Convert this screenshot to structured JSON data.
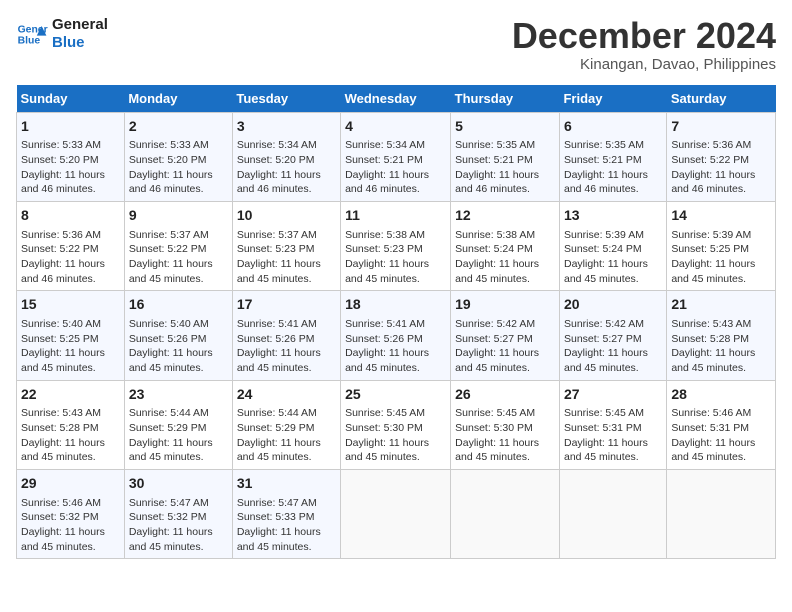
{
  "logo": {
    "line1": "General",
    "line2": "Blue"
  },
  "title": "December 2024",
  "subtitle": "Kinangan, Davao, Philippines",
  "days_header": [
    "Sunday",
    "Monday",
    "Tuesday",
    "Wednesday",
    "Thursday",
    "Friday",
    "Saturday"
  ],
  "weeks": [
    [
      {
        "day": "1",
        "sunrise": "5:33 AM",
        "sunset": "5:20 PM",
        "daylight": "11 hours and 46 minutes."
      },
      {
        "day": "2",
        "sunrise": "5:33 AM",
        "sunset": "5:20 PM",
        "daylight": "11 hours and 46 minutes."
      },
      {
        "day": "3",
        "sunrise": "5:34 AM",
        "sunset": "5:20 PM",
        "daylight": "11 hours and 46 minutes."
      },
      {
        "day": "4",
        "sunrise": "5:34 AM",
        "sunset": "5:21 PM",
        "daylight": "11 hours and 46 minutes."
      },
      {
        "day": "5",
        "sunrise": "5:35 AM",
        "sunset": "5:21 PM",
        "daylight": "11 hours and 46 minutes."
      },
      {
        "day": "6",
        "sunrise": "5:35 AM",
        "sunset": "5:21 PM",
        "daylight": "11 hours and 46 minutes."
      },
      {
        "day": "7",
        "sunrise": "5:36 AM",
        "sunset": "5:22 PM",
        "daylight": "11 hours and 46 minutes."
      }
    ],
    [
      {
        "day": "8",
        "sunrise": "5:36 AM",
        "sunset": "5:22 PM",
        "daylight": "11 hours and 46 minutes."
      },
      {
        "day": "9",
        "sunrise": "5:37 AM",
        "sunset": "5:22 PM",
        "daylight": "11 hours and 45 minutes."
      },
      {
        "day": "10",
        "sunrise": "5:37 AM",
        "sunset": "5:23 PM",
        "daylight": "11 hours and 45 minutes."
      },
      {
        "day": "11",
        "sunrise": "5:38 AM",
        "sunset": "5:23 PM",
        "daylight": "11 hours and 45 minutes."
      },
      {
        "day": "12",
        "sunrise": "5:38 AM",
        "sunset": "5:24 PM",
        "daylight": "11 hours and 45 minutes."
      },
      {
        "day": "13",
        "sunrise": "5:39 AM",
        "sunset": "5:24 PM",
        "daylight": "11 hours and 45 minutes."
      },
      {
        "day": "14",
        "sunrise": "5:39 AM",
        "sunset": "5:25 PM",
        "daylight": "11 hours and 45 minutes."
      }
    ],
    [
      {
        "day": "15",
        "sunrise": "5:40 AM",
        "sunset": "5:25 PM",
        "daylight": "11 hours and 45 minutes."
      },
      {
        "day": "16",
        "sunrise": "5:40 AM",
        "sunset": "5:26 PM",
        "daylight": "11 hours and 45 minutes."
      },
      {
        "day": "17",
        "sunrise": "5:41 AM",
        "sunset": "5:26 PM",
        "daylight": "11 hours and 45 minutes."
      },
      {
        "day": "18",
        "sunrise": "5:41 AM",
        "sunset": "5:26 PM",
        "daylight": "11 hours and 45 minutes."
      },
      {
        "day": "19",
        "sunrise": "5:42 AM",
        "sunset": "5:27 PM",
        "daylight": "11 hours and 45 minutes."
      },
      {
        "day": "20",
        "sunrise": "5:42 AM",
        "sunset": "5:27 PM",
        "daylight": "11 hours and 45 minutes."
      },
      {
        "day": "21",
        "sunrise": "5:43 AM",
        "sunset": "5:28 PM",
        "daylight": "11 hours and 45 minutes."
      }
    ],
    [
      {
        "day": "22",
        "sunrise": "5:43 AM",
        "sunset": "5:28 PM",
        "daylight": "11 hours and 45 minutes."
      },
      {
        "day": "23",
        "sunrise": "5:44 AM",
        "sunset": "5:29 PM",
        "daylight": "11 hours and 45 minutes."
      },
      {
        "day": "24",
        "sunrise": "5:44 AM",
        "sunset": "5:29 PM",
        "daylight": "11 hours and 45 minutes."
      },
      {
        "day": "25",
        "sunrise": "5:45 AM",
        "sunset": "5:30 PM",
        "daylight": "11 hours and 45 minutes."
      },
      {
        "day": "26",
        "sunrise": "5:45 AM",
        "sunset": "5:30 PM",
        "daylight": "11 hours and 45 minutes."
      },
      {
        "day": "27",
        "sunrise": "5:45 AM",
        "sunset": "5:31 PM",
        "daylight": "11 hours and 45 minutes."
      },
      {
        "day": "28",
        "sunrise": "5:46 AM",
        "sunset": "5:31 PM",
        "daylight": "11 hours and 45 minutes."
      }
    ],
    [
      {
        "day": "29",
        "sunrise": "5:46 AM",
        "sunset": "5:32 PM",
        "daylight": "11 hours and 45 minutes."
      },
      {
        "day": "30",
        "sunrise": "5:47 AM",
        "sunset": "5:32 PM",
        "daylight": "11 hours and 45 minutes."
      },
      {
        "day": "31",
        "sunrise": "5:47 AM",
        "sunset": "5:33 PM",
        "daylight": "11 hours and 45 minutes."
      },
      null,
      null,
      null,
      null
    ]
  ],
  "labels": {
    "sunrise_prefix": "Sunrise: ",
    "sunset_prefix": "Sunset: ",
    "daylight_prefix": "Daylight: "
  }
}
